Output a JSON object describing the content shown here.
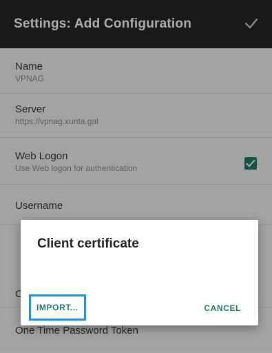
{
  "topbar": {
    "title": "Settings: Add Configuration",
    "confirm_icon": "check-icon"
  },
  "settings": {
    "rows": [
      {
        "label": "Name",
        "value": "VPNAG"
      },
      {
        "label": "Server",
        "value": "https://vpnag.xunta.gal"
      },
      {
        "label": "Web Logon",
        "value": "Use Web logon for authentication",
        "checked": true
      },
      {
        "label": "Username"
      },
      {
        "label": "C"
      },
      {
        "label": "One Time Password Token"
      }
    ]
  },
  "dialog": {
    "title": "Client certificate",
    "import_label": "IMPORT...",
    "cancel_label": "CANCEL"
  },
  "colors": {
    "accent": "#1f7a6a",
    "highlight": "#1e90e0",
    "topbar": "#262626"
  }
}
